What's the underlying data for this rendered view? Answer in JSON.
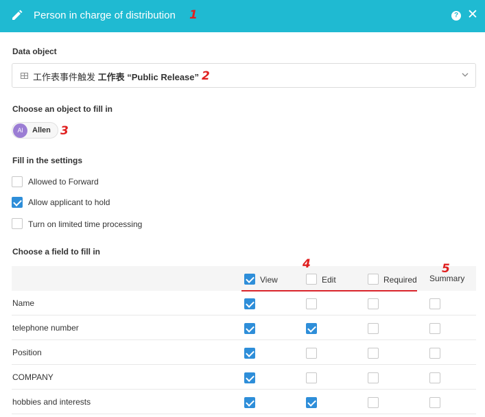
{
  "header": {
    "title": "Person in charge of distribution",
    "help_glyph": "?",
    "close_glyph": "✕",
    "bg_color": "#1fbad2"
  },
  "markers": [
    "1",
    "2",
    "3",
    "4",
    "5"
  ],
  "data_object": {
    "label": "Data object",
    "value_prefix": "工作表事件触发",
    "value_bold": "工作表 “Public Release”"
  },
  "fill_object": {
    "label": "Choose an object to fill in",
    "user": {
      "initials": "Al",
      "name": "Allen"
    }
  },
  "settings": {
    "label": "Fill in the settings",
    "options": [
      {
        "label": "Allowed to Forward",
        "checked": false
      },
      {
        "label": "Allow applicant to hold",
        "checked": true
      },
      {
        "label": "Turn on limited time processing",
        "checked": false
      }
    ]
  },
  "fields": {
    "label": "Choose a field to fill in",
    "columns": {
      "view": {
        "label": "View",
        "checked": true
      },
      "edit": {
        "label": "Edit",
        "checked": false
      },
      "required": {
        "label": "Required",
        "checked": false
      },
      "summary": {
        "label": "Summary"
      }
    },
    "rows": [
      {
        "name": "Name",
        "view": true,
        "edit": false,
        "required": false,
        "summary": false
      },
      {
        "name": "telephone number",
        "view": true,
        "edit": true,
        "required": false,
        "summary": false
      },
      {
        "name": "Position",
        "view": true,
        "edit": false,
        "required": false,
        "summary": false
      },
      {
        "name": "COMPANY",
        "view": true,
        "edit": false,
        "required": false,
        "summary": false
      },
      {
        "name": "hobbies and interests",
        "view": true,
        "edit": true,
        "required": false,
        "summary": false
      }
    ]
  },
  "colors": {
    "accent": "#1fbad2",
    "checkbox": "#2e8ed9",
    "annotation": "#d9232a",
    "avatar": "#9b7dd4"
  }
}
